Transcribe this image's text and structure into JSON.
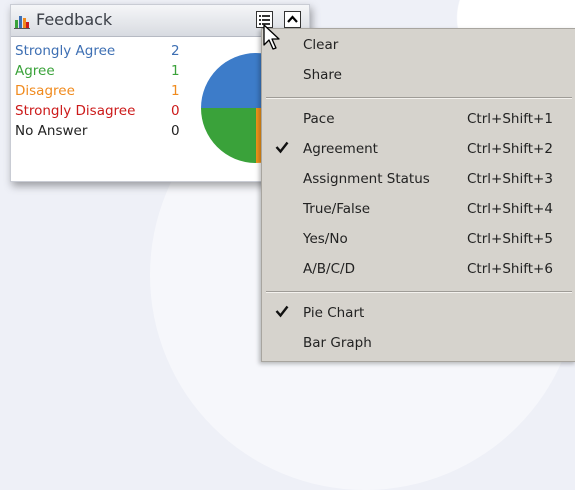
{
  "widget": {
    "title": "Feedback",
    "rows": [
      {
        "label": "Strongly Agree",
        "count": "2",
        "color": "#3d6fb3"
      },
      {
        "label": "Agree",
        "count": "1",
        "color": "#3aa23a"
      },
      {
        "label": "Disagree",
        "count": "1",
        "color": "#f08a1d"
      },
      {
        "label": "Strongly Disagree",
        "count": "0",
        "color": "#cc1a1a"
      },
      {
        "label": "No Answer",
        "count": "0",
        "color": "#222222"
      }
    ],
    "pie_colors": [
      "#3d7cc9",
      "#3aa23a",
      "#f0941a"
    ]
  },
  "menu": {
    "clear": "Clear",
    "share": "Share",
    "types": [
      {
        "label": "Pace",
        "shortcut": "Ctrl+Shift+1",
        "checked": false
      },
      {
        "label": "Agreement",
        "shortcut": "Ctrl+Shift+2",
        "checked": true
      },
      {
        "label": "Assignment Status",
        "shortcut": "Ctrl+Shift+3",
        "checked": false
      },
      {
        "label": "True/False",
        "shortcut": "Ctrl+Shift+4",
        "checked": false
      },
      {
        "label": "Yes/No",
        "shortcut": "Ctrl+Shift+5",
        "checked": false
      },
      {
        "label": "A/B/C/D",
        "shortcut": "Ctrl+Shift+6",
        "checked": false
      }
    ],
    "views": [
      {
        "label": "Pie Chart",
        "checked": true
      },
      {
        "label": "Bar Graph",
        "checked": false
      }
    ]
  }
}
